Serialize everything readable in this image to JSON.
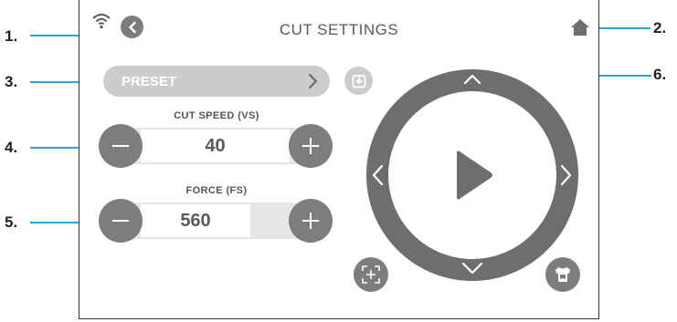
{
  "title": "CUT SETTINGS",
  "callouts": {
    "c1": "1.",
    "c2": "2.",
    "c3": "3.",
    "c4": "4.",
    "c5": "5.",
    "c6": "6."
  },
  "preset": {
    "label": "PRESET"
  },
  "cut_speed": {
    "label": "CUT SPEED (VS)",
    "value": "40"
  },
  "force": {
    "label": "FORCE (FS)",
    "value": "560"
  },
  "colors": {
    "accent_line": "#2aa6d8",
    "button_gray": "#7d7d7d",
    "ring_gray": "#6e6e6e",
    "preset_gray": "#cccccc"
  },
  "icons": [
    "wifi-icon",
    "back-icon",
    "home-icon",
    "chevron-right-icon",
    "save-preset-icon",
    "arrow-up-icon",
    "arrow-down-icon",
    "arrow-left-icon",
    "arrow-right-icon",
    "play-icon",
    "frame-select-icon",
    "tshirt-icon",
    "minus-icon",
    "plus-icon"
  ]
}
